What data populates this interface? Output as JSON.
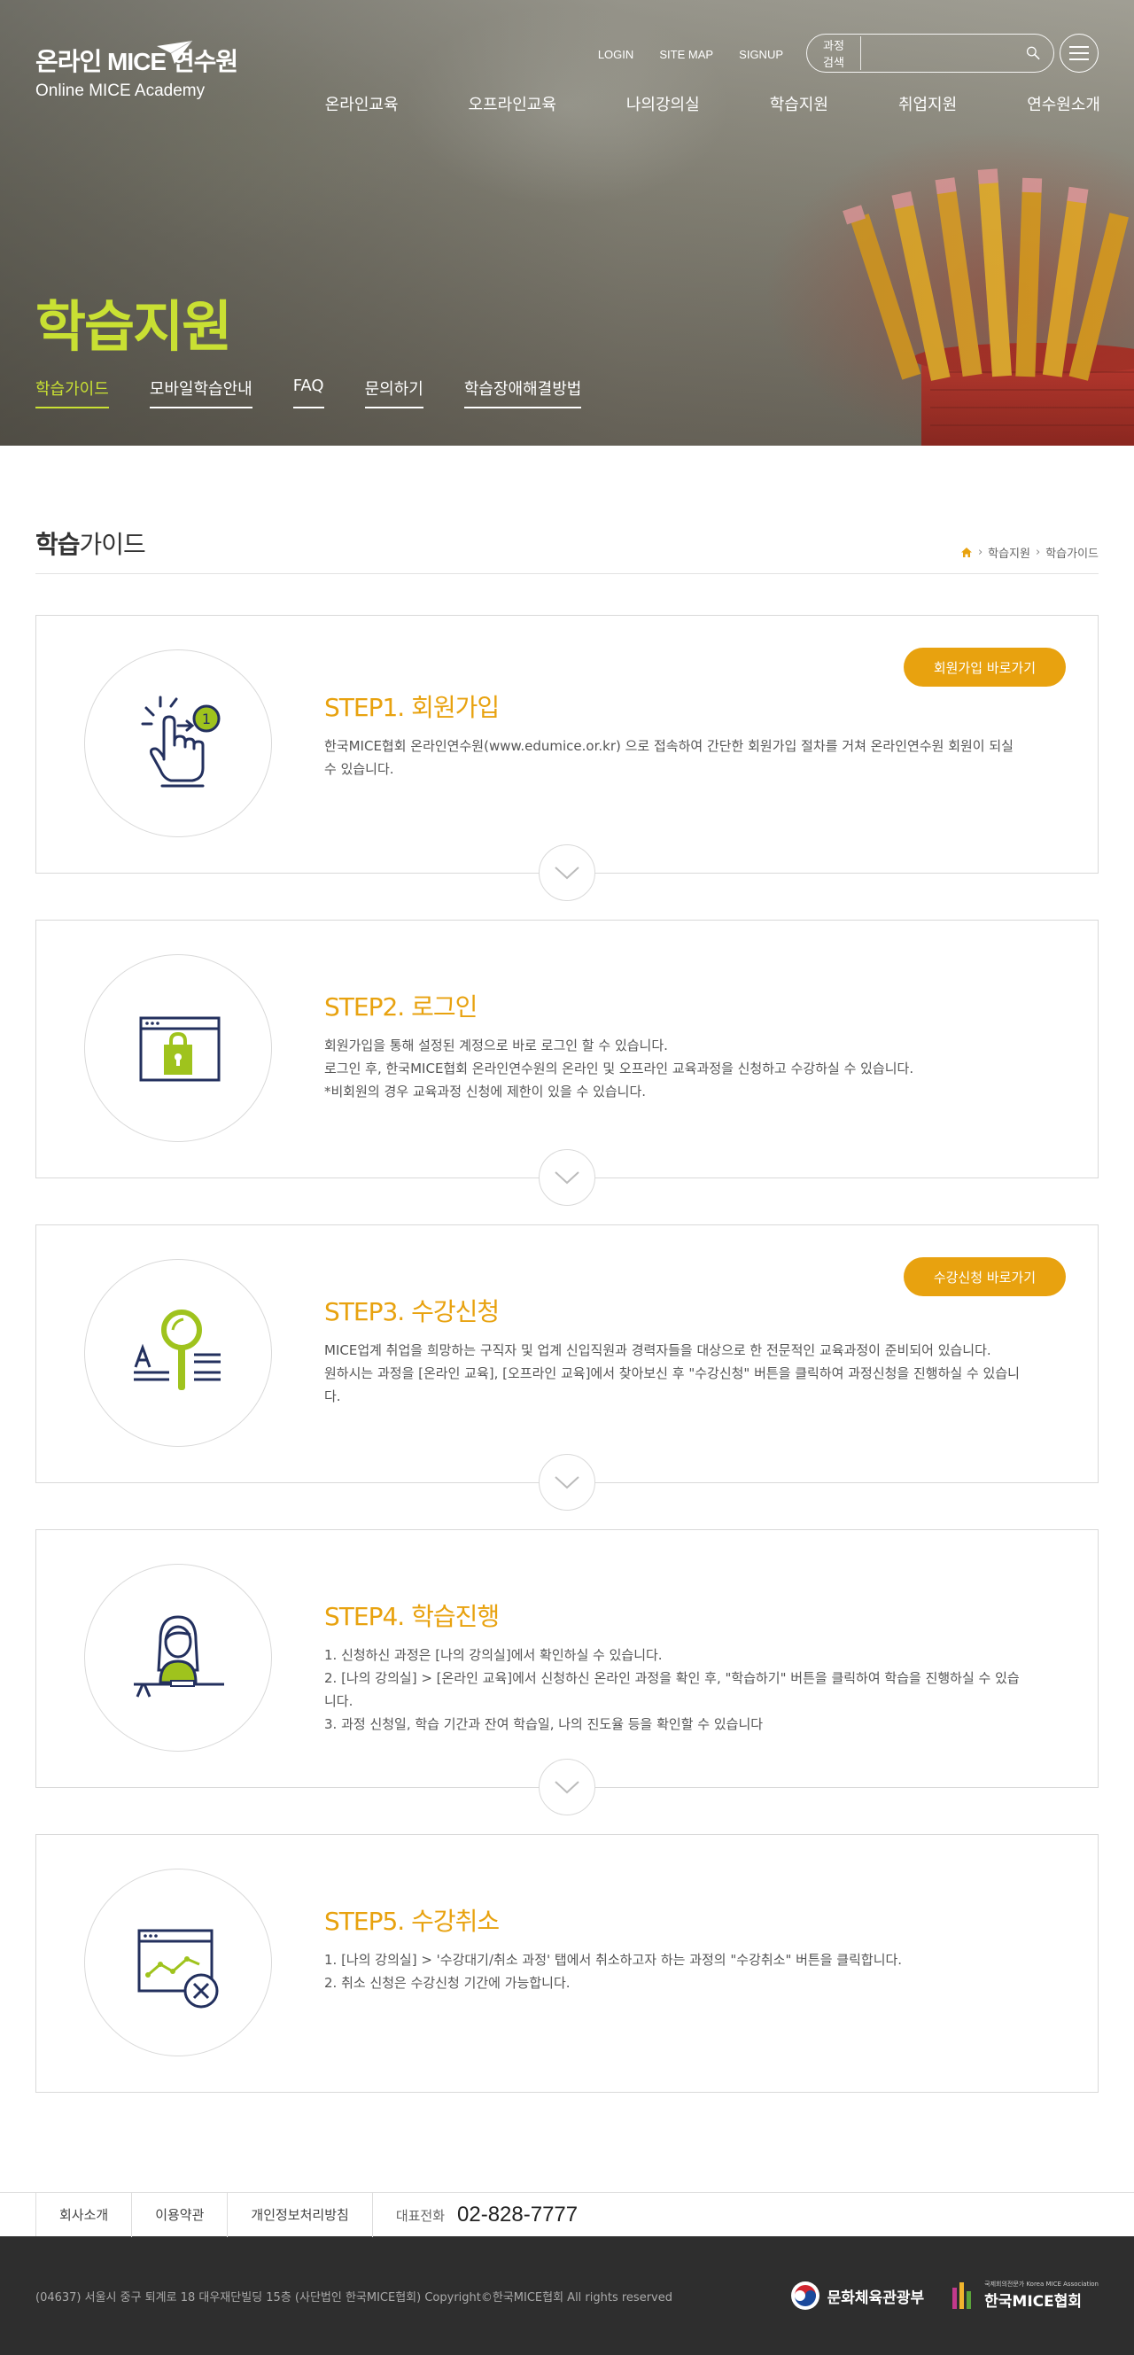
{
  "header": {
    "logo_ko": "온라인 MICE 연수원",
    "logo_en": "Online MICE Academy",
    "util": [
      "LOGIN",
      "SITE MAP",
      "SIGNUP"
    ],
    "search_label": "과정검색",
    "nav": [
      "온라인교육",
      "오프라인교육",
      "나의강의실",
      "학습지원",
      "취업지원",
      "연수원소개"
    ]
  },
  "hero": {
    "title": "학습지원",
    "tabs": [
      "학습가이드",
      "모바일학습안내",
      "FAQ",
      "문의하기",
      "학습장애해결방법"
    ],
    "active_tab": 0
  },
  "page": {
    "title_bold": "학습",
    "title_rest": "가이드",
    "breadcrumb": [
      "학습지원",
      "학습가이드"
    ]
  },
  "steps": [
    {
      "title": "STEP1. 회원가입",
      "lines": [
        "한국MICE협회 온라인연수원(www.edumice.or.kr) 으로 접속하여 간단한 회원가입 절차를 거쳐 온라인연수원 회원이 되실 수 있습니다."
      ],
      "button": "회원가입 바로가기",
      "icon": "touch-icon"
    },
    {
      "title": "STEP2. 로그인",
      "lines": [
        "회원가입을 통해 설정된 계정으로 바로 로그인 할 수 있습니다.",
        "로그인 후, 한국MICE협회 온라인연수원의 온라인 및 오프라인 교육과정을 신청하고 수강하실 수 있습니다.",
        "*비회원의 경우 교육과정 신청에 제한이 있을 수 있습니다."
      ],
      "button": "",
      "icon": "lock-window-icon"
    },
    {
      "title": "STEP3. 수강신청",
      "lines": [
        "MICE업계 취업을 희망하는 구직자 및 업계 신입직원과 경력자들을 대상으로 한 전문적인 교육과정이 준비되어 있습니다.",
        "원하시는 과정을 [온라인 교육], [오프라인 교육]에서 찾아보신 후 \"수강신청\" 버튼을 클릭하여 과정신청을 진행하실 수 있습니다."
      ],
      "button": "수강신청 바로가기",
      "icon": "magnifier-text-icon"
    },
    {
      "title": "STEP4. 학습진행",
      "lines": [
        "1. 신청하신 과정은 [나의 강의실]에서 확인하실 수 있습니다.",
        "2. [나의 강의실] > [온라인 교육]에서 신청하신 온라인 과정을 확인 후, \"학습하기\" 버튼을 클릭하여 학습을 진행하실 수 있습니다.",
        "3. 과정 신청일, 학습 기간과 잔여 학습일, 나의 진도율 등을 확인할 수 있습니다"
      ],
      "button": "",
      "icon": "student-desk-icon"
    },
    {
      "title": "STEP5. 수강취소",
      "lines": [
        "1. [나의 강의실] > '수강대기/취소 과정' 탭에서 취소하고자 하는 과정의 \"수강취소\" 버튼을 클릭합니다.",
        "2. 취소 신청은 수강신청 기간에 가능합니다."
      ],
      "button": "",
      "icon": "window-cancel-icon"
    }
  ],
  "footer": {
    "links": [
      "회사소개",
      "이용약관",
      "개인정보처리방침"
    ],
    "tel_label": "대표전화",
    "tel": "02-828-7777",
    "address": "(04637) 서울시 중구 퇴계로 18 대우재단빌딩 15층 (사단법인 한국MICE협회) Copyright©한국MICE협회 All rights reserved",
    "logo1": "문화체육관광부",
    "logo2": "한국MICE협회",
    "logo2_sub": "국제회의전문가 Korea MICE Association"
  },
  "colors": {
    "accent": "#e8a20f",
    "hero_green": "#c9e033",
    "icon_green": "#9fc31d",
    "icon_navy": "#23305e"
  }
}
